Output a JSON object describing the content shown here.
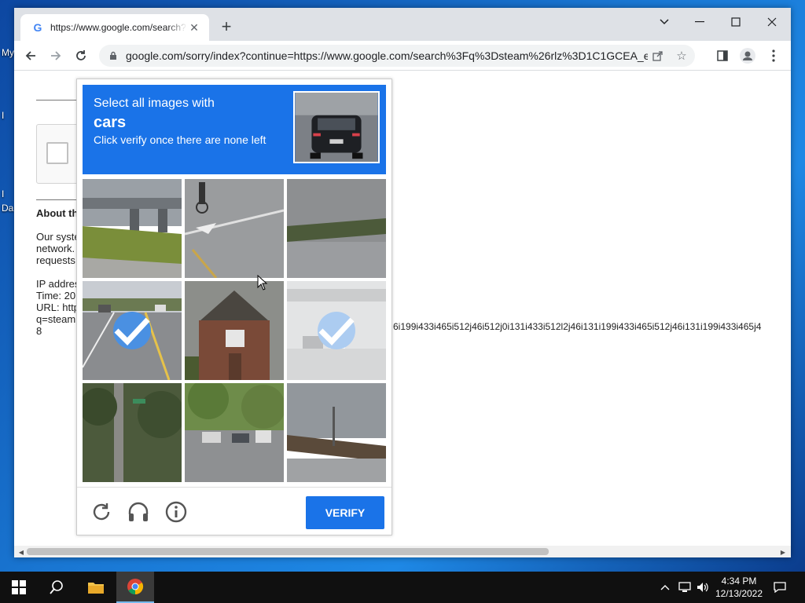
{
  "desktop": {
    "icon_labels": [
      "My",
      "I",
      "I",
      "Da"
    ]
  },
  "browser": {
    "tab": {
      "title": "https://www.google.com/search?",
      "favicon": "G"
    },
    "url": "google.com/sorry/index?continue=https://www.google.com/search%3Fq%3Dsteam%26rlz%3D1C1GCEA_e..."
  },
  "page": {
    "about_title": "About th",
    "para1": [
      "Our syste",
      "network.",
      "requests"
    ],
    "para2": [
      "IP addres",
      "Time: 20",
      "URL: http",
      "q=steam",
      "8"
    ],
    "long_url": "6i199i433i465i512j46i512j0i131i433i512l2j46i131i199i433i465i512j46i131i199i433i465j4"
  },
  "captcha": {
    "prompt": "Select all images with",
    "object": "cars",
    "instruction": "Click verify once there are none left",
    "verify_label": "VERIFY",
    "tiles": [
      {
        "scene": "overpass-grass",
        "selected": false
      },
      {
        "scene": "road-cyclist",
        "selected": false
      },
      {
        "scene": "road-edge",
        "selected": false
      },
      {
        "scene": "street-cars",
        "selected": true
      },
      {
        "scene": "brick-house",
        "selected": false
      },
      {
        "scene": "overpass-cars",
        "selected": true
      },
      {
        "scene": "trees-pole",
        "selected": false
      },
      {
        "scene": "parked-cars",
        "selected": false
      },
      {
        "scene": "field-pole",
        "selected": false
      }
    ]
  },
  "taskbar": {
    "time": "4:34 PM",
    "date": "12/13/2022"
  },
  "colors": {
    "accent": "#1a73e8",
    "check": "#4a90e2"
  }
}
